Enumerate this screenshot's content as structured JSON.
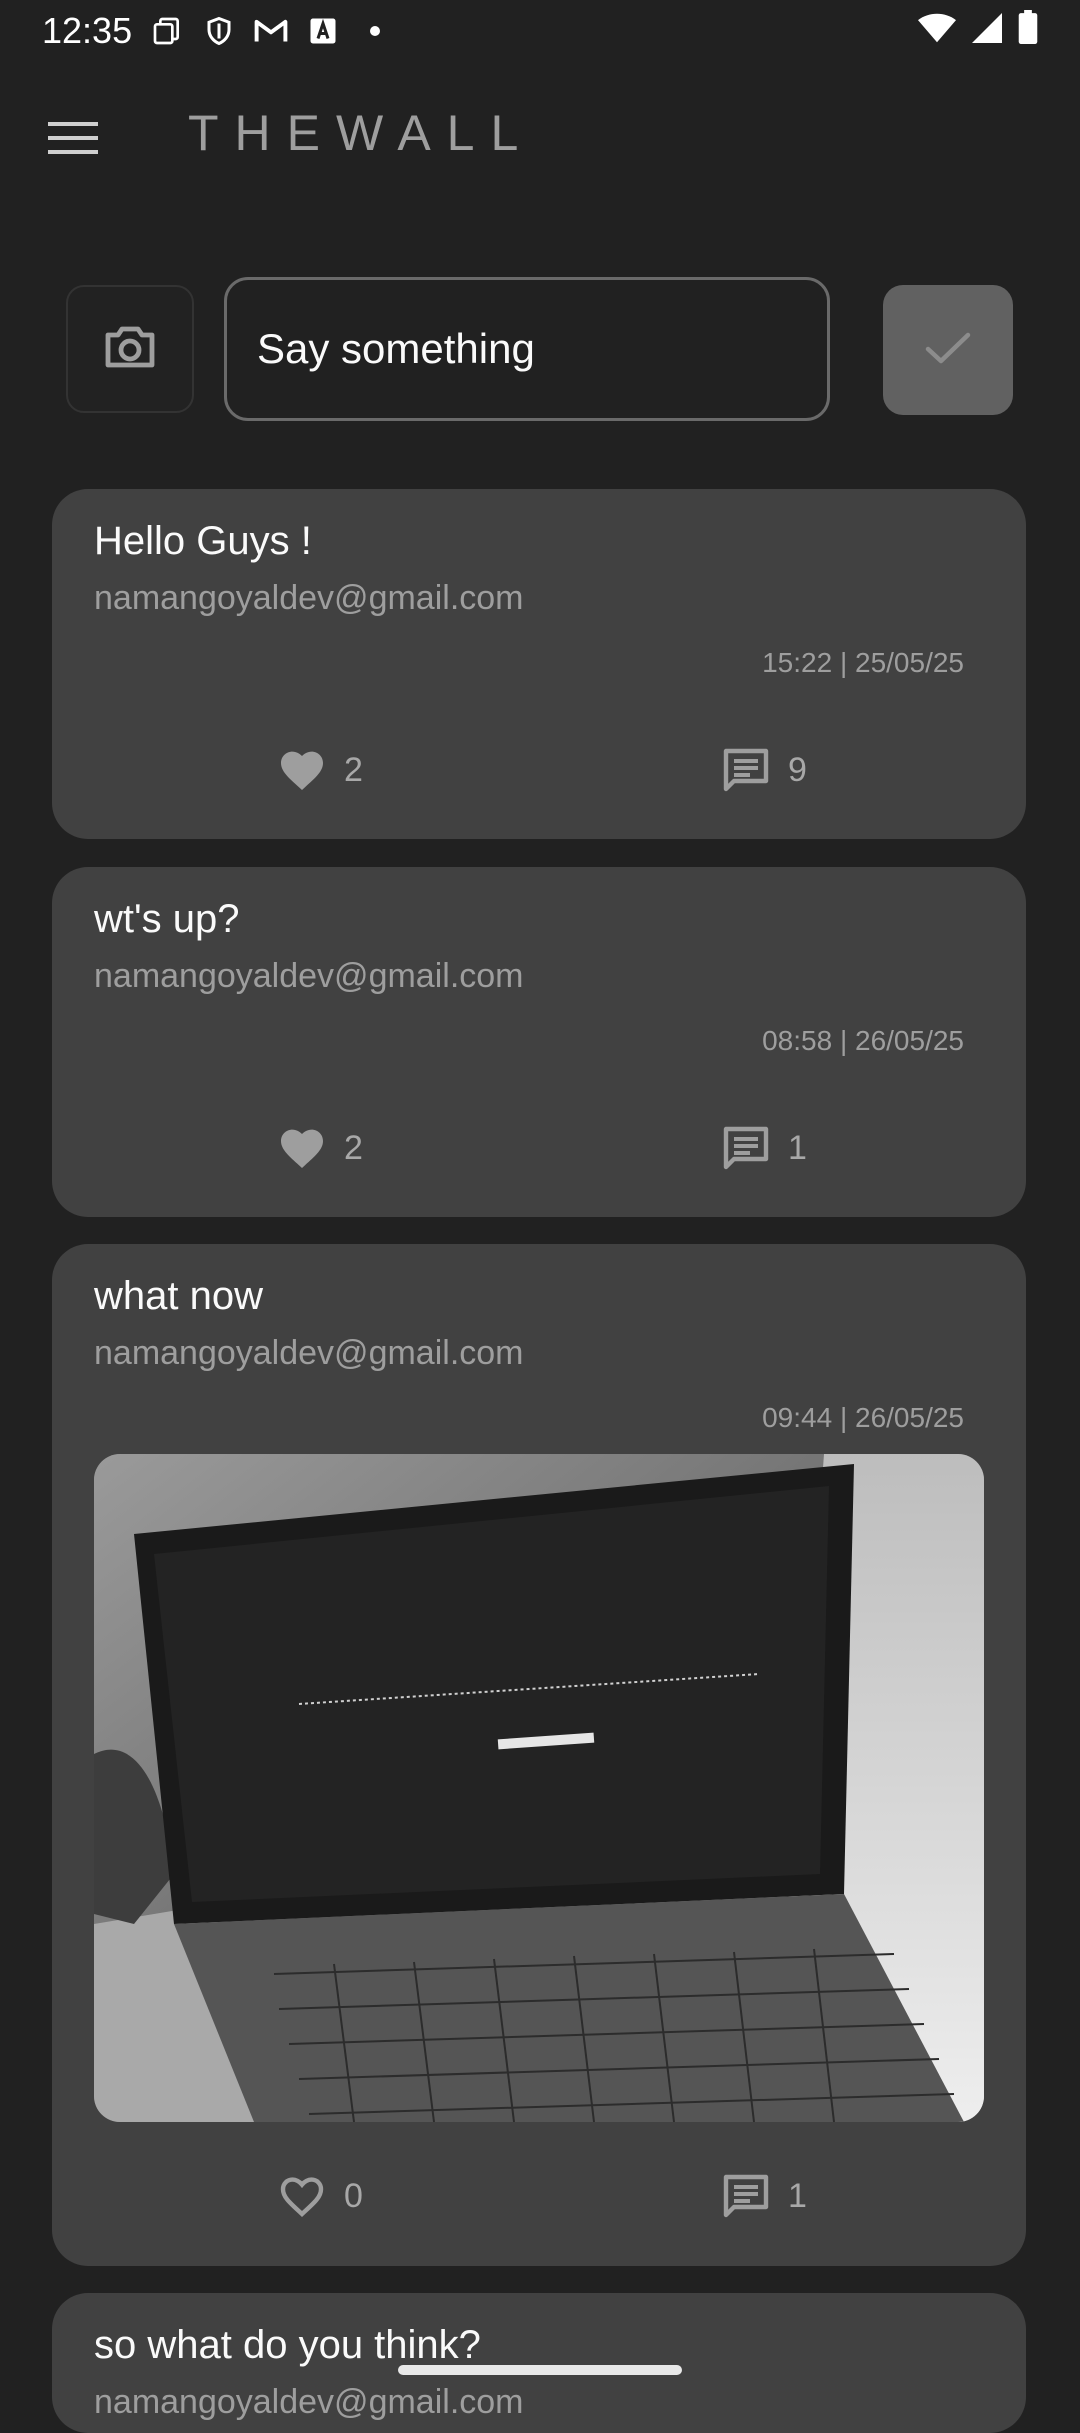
{
  "status_bar": {
    "time": "12:35"
  },
  "app": {
    "title": "THEWALL"
  },
  "composer": {
    "placeholder": "Say something"
  },
  "posts": [
    {
      "message": "Hello Guys !",
      "email": "namangoyaldev@gmail.com",
      "timestamp": "15:22 | 25/05/25",
      "likes": "2",
      "comments": "9",
      "liked": true,
      "has_image": false
    },
    {
      "message": "wt's up?",
      "email": "namangoyaldev@gmail.com",
      "timestamp": "08:58 | 26/05/25",
      "likes": "2",
      "comments": "1",
      "liked": true,
      "has_image": false
    },
    {
      "message": "what now",
      "email": "namangoyaldev@gmail.com",
      "timestamp": "09:44 | 26/05/25",
      "likes": "0",
      "comments": "1",
      "liked": false,
      "has_image": true
    },
    {
      "message": "so what do you think?",
      "email": "namangoyaldev@gmail.com"
    }
  ],
  "colors": {
    "background": "#212121",
    "card": "#414141",
    "muted_text": "#9e9e9e",
    "send_button": "#616161"
  }
}
